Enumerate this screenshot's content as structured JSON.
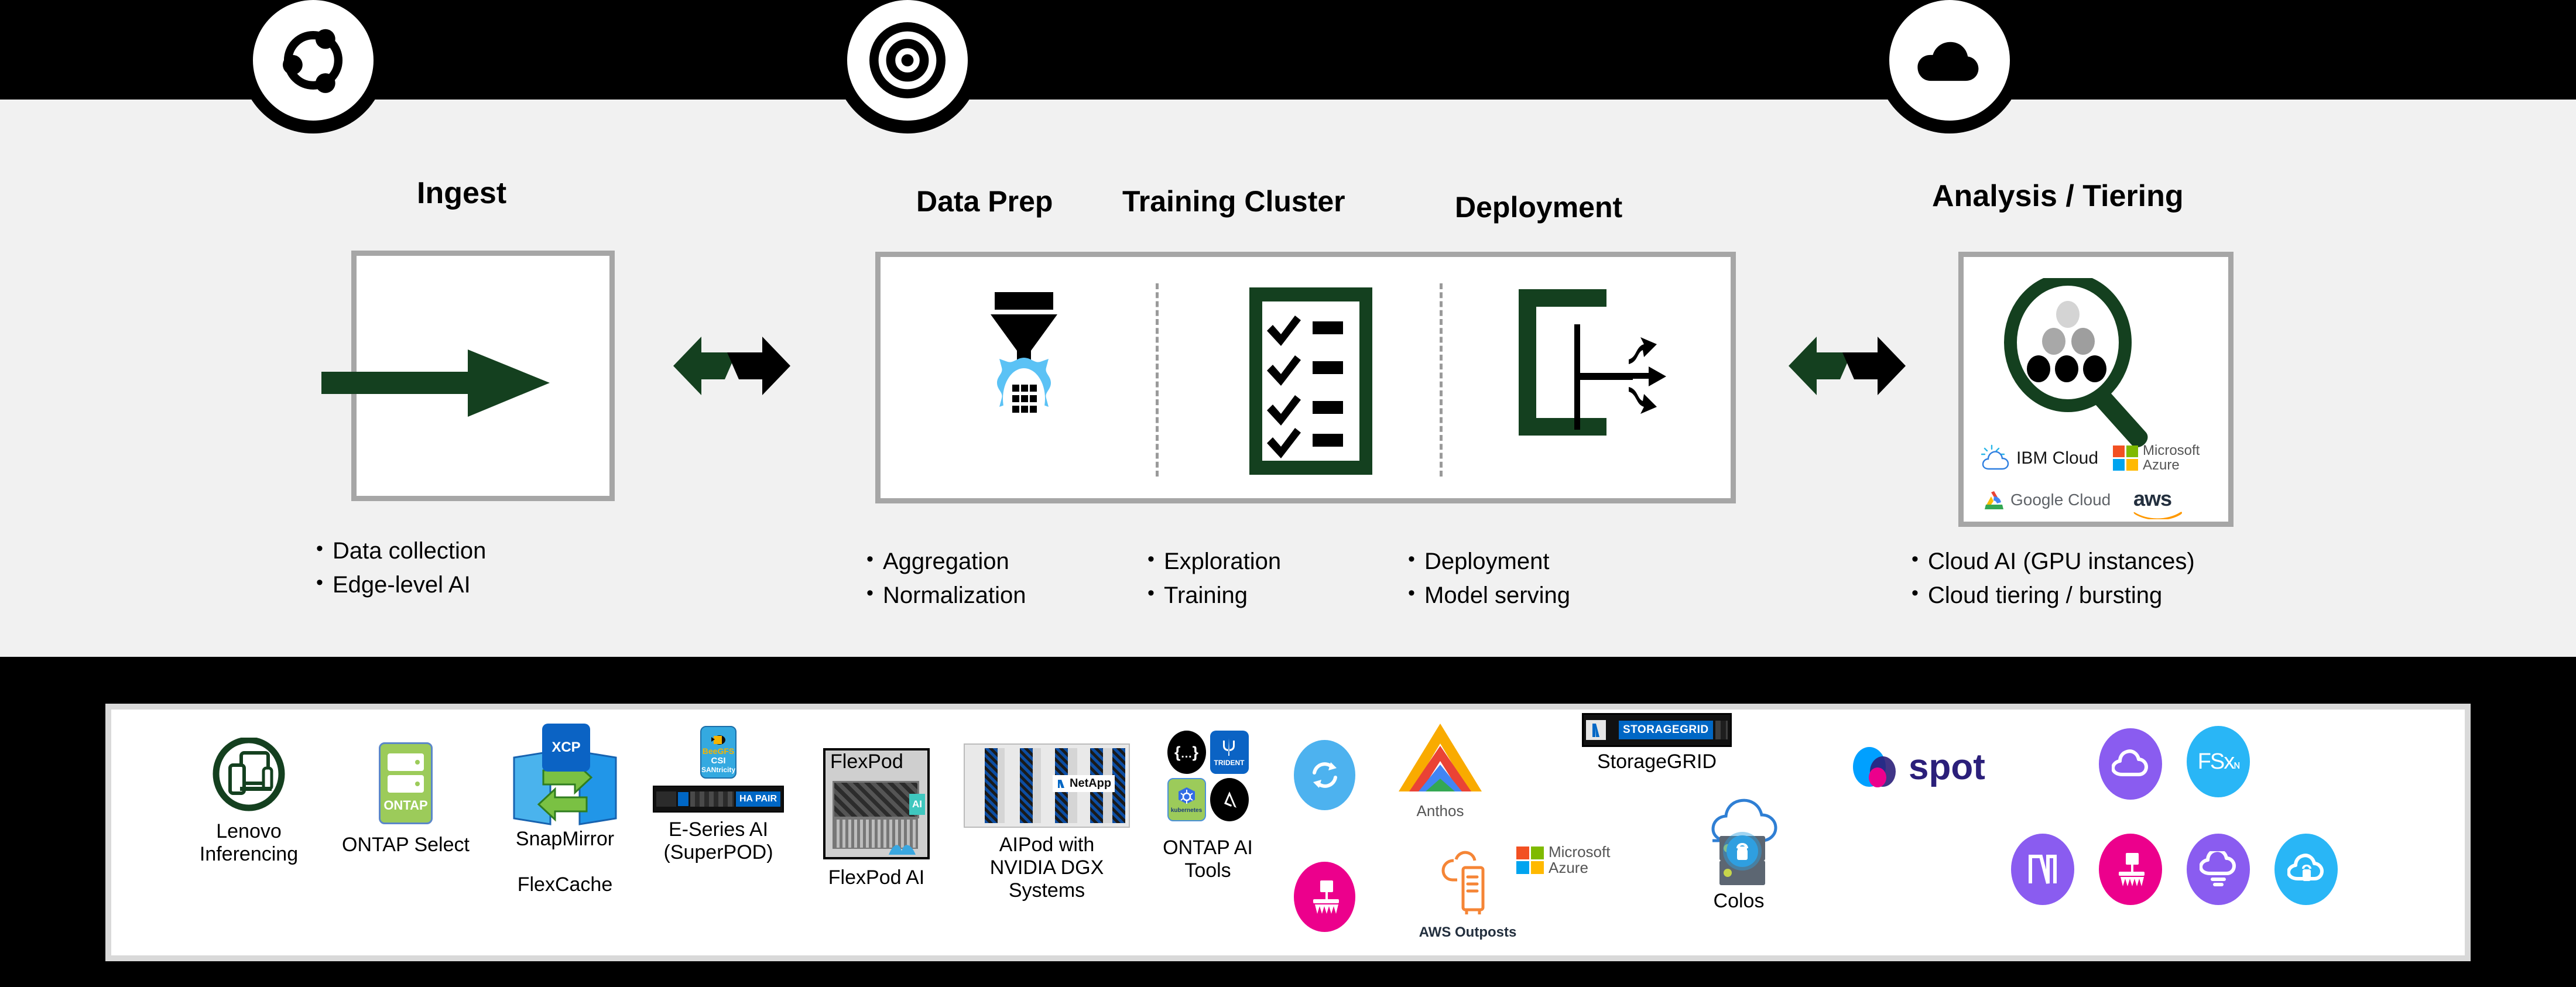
{
  "theme": {
    "bg": "#f1f1f1",
    "band": "#000000",
    "panel_border": "#a6a6a6",
    "brand_green": "#14401f",
    "accent_blue": "#5bc2f5",
    "ontap_green": "#9ccb5a",
    "netapp_blue": "#0067c5",
    "magenta": "#ec008c",
    "purple": "#8a5cf0",
    "cyan": "#29b6f6"
  },
  "stages": [
    {
      "id": "ingest",
      "title": "Ingest",
      "badge_icon": "network-nodes-icon",
      "bullets": [
        "Data collection",
        "Edge-level AI"
      ]
    },
    {
      "id": "train",
      "title_group": [
        "Data Prep",
        "Training Cluster",
        "Deployment"
      ],
      "badge_icon": "target-bullseye-icon",
      "bullets_columns": [
        [
          "Aggregation",
          "Normalization"
        ],
        [
          "Exploration",
          "Training"
        ],
        [
          "Deployment",
          "Model serving"
        ]
      ],
      "sub_icons": [
        "funnel-gear-icon",
        "checklist-icon",
        "model-serving-icon"
      ]
    },
    {
      "id": "analysis",
      "title": "Analysis / Tiering",
      "badge_icon": "cloud-icon",
      "bullets": [
        "Cloud AI (GPU instances)",
        "Cloud tiering / bursting"
      ],
      "cloud_logos": [
        "IBM Cloud",
        "Microsoft Azure",
        "Google Cloud",
        "aws"
      ]
    }
  ],
  "exchange_arrows": [
    {
      "id": "arrow-ingest-to-train",
      "icon": "bidirectional-arrows-icon"
    },
    {
      "id": "arrow-train-to-analysis",
      "icon": "bidirectional-arrows-icon"
    }
  ],
  "products": [
    {
      "id": "lenovo-inferencing",
      "label": "Lenovo\nInferencing",
      "icon": "lenovo-device-ring-icon"
    },
    {
      "id": "ontap-select",
      "label": "ONTAP Select",
      "icon": "ontap-chip-icon",
      "chip_text": "ONTAP"
    },
    {
      "id": "snapmirror-flexcache",
      "label": "SnapMirror\n\nFlexCache",
      "icon": "xcp-snapmirror-icon",
      "chip_text": "XCP"
    },
    {
      "id": "e-series-ai",
      "label": "E-Series AI\n(SuperPOD)",
      "icon": "beegfs-csi-santricity-icon",
      "chip_lines": [
        "BeeGFS",
        "CSI",
        "SANtricity"
      ],
      "device_text": "HA PAIR"
    },
    {
      "id": "flexpod-ai",
      "label": "FlexPod AI",
      "icon": "flexpod-rack-icon",
      "panel_title": "FlexPod",
      "badge_text": "AI"
    },
    {
      "id": "aipod-nvidia-dgx",
      "label": "AIPod with\nNVIDIA DGX\nSystems",
      "icon": "netapp-rack-icon",
      "logo_text": "NetApp"
    },
    {
      "id": "ontap-ai-tools",
      "label": "ONTAP AI\nTools",
      "icon": "ontap-ai-tools-icon",
      "sub_logos": [
        "astra-braces",
        "TRIDENT",
        "kubernetes",
        "ansible"
      ]
    },
    {
      "id": "sync-copy-sync",
      "label": "",
      "icon": "cloud-sync-icon"
    },
    {
      "id": "data-broom",
      "label": "",
      "icon": "data-broom-icon"
    },
    {
      "id": "anthos",
      "label": "Anthos",
      "icon": "anthos-icon"
    },
    {
      "id": "aws-outposts",
      "label": "AWS Outposts",
      "icon": "aws-outposts-icon"
    },
    {
      "id": "azure-badge",
      "label": "Microsoft\nAzure",
      "icon": "microsoft-azure-icon"
    },
    {
      "id": "storagegrid",
      "label": "StorageGRID",
      "icon": "storagegrid-appliance-icon",
      "chip_text": "STORAGEGRID"
    },
    {
      "id": "colos",
      "label": "Colos",
      "icon": "colo-cloud-lock-icon"
    },
    {
      "id": "spot",
      "label": "",
      "icon": "spot-logo-icon",
      "logo_text": "spot"
    },
    {
      "id": "cloud-volumes",
      "label": "",
      "icon": "cloud-volumes-icon"
    },
    {
      "id": "fsx",
      "label": "",
      "icon": "fsx-netapp-icon",
      "logo_text": "FSx"
    },
    {
      "id": "cloud-manager",
      "label": "",
      "icon": "netapp-n-icon"
    },
    {
      "id": "cloud-sweep",
      "label": "",
      "icon": "data-broom-icon"
    },
    {
      "id": "cloud-tiering",
      "label": "",
      "icon": "cloud-tiering-icon"
    },
    {
      "id": "cloud-backup",
      "label": "",
      "icon": "cloud-lock-icon"
    }
  ]
}
